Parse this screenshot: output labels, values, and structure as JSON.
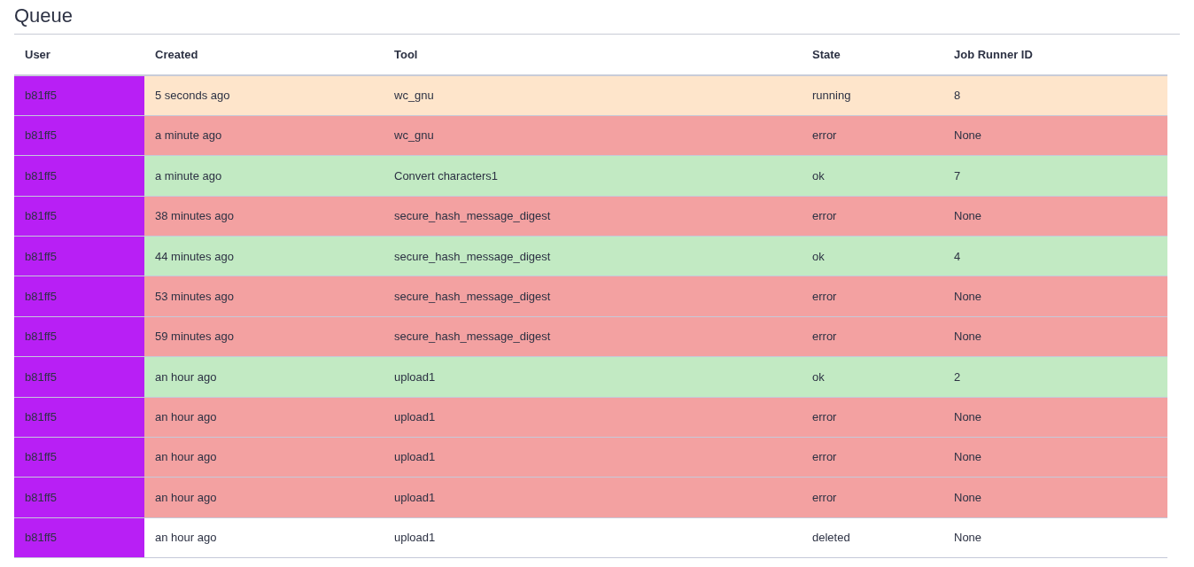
{
  "title": "Queue",
  "table": {
    "columns": [
      "User",
      "Created",
      "Tool",
      "State",
      "Job Runner ID"
    ],
    "rows": [
      {
        "user": "b81ff5",
        "color": "#b81ff5",
        "created": "5 seconds ago",
        "tool": "wc_gnu",
        "state": "running",
        "job_runner_id": "8"
      },
      {
        "user": "b81ff5",
        "color": "#b81ff5",
        "created": "a minute ago",
        "tool": "wc_gnu",
        "state": "error",
        "job_runner_id": "None"
      },
      {
        "user": "b81ff5",
        "color": "#b81ff5",
        "created": "a minute ago",
        "tool": "Convert characters1",
        "state": "ok",
        "job_runner_id": "7"
      },
      {
        "user": "b81ff5",
        "color": "#b81ff5",
        "created": "38 minutes ago",
        "tool": "secure_hash_message_digest",
        "state": "error",
        "job_runner_id": "None"
      },
      {
        "user": "b81ff5",
        "color": "#b81ff5",
        "created": "44 minutes ago",
        "tool": "secure_hash_message_digest",
        "state": "ok",
        "job_runner_id": "4"
      },
      {
        "user": "b81ff5",
        "color": "#b81ff5",
        "created": "53 minutes ago",
        "tool": "secure_hash_message_digest",
        "state": "error",
        "job_runner_id": "None"
      },
      {
        "user": "b81ff5",
        "color": "#b81ff5",
        "created": "59 minutes ago",
        "tool": "secure_hash_message_digest",
        "state": "error",
        "job_runner_id": "None"
      },
      {
        "user": "b81ff5",
        "color": "#b81ff5",
        "created": "an hour ago",
        "tool": "upload1",
        "state": "ok",
        "job_runner_id": "2"
      },
      {
        "user": "b81ff5",
        "color": "#b81ff5",
        "created": "an hour ago",
        "tool": "upload1",
        "state": "error",
        "job_runner_id": "None"
      },
      {
        "user": "b81ff5",
        "color": "#b81ff5",
        "created": "an hour ago",
        "tool": "upload1",
        "state": "error",
        "job_runner_id": "None"
      },
      {
        "user": "b81ff5",
        "color": "#b81ff5",
        "created": "an hour ago",
        "tool": "upload1",
        "state": "error",
        "job_runner_id": "None"
      },
      {
        "user": "b81ff5",
        "color": "#b81ff5",
        "created": "an hour ago",
        "tool": "upload1",
        "state": "deleted",
        "job_runner_id": "None"
      }
    ]
  }
}
